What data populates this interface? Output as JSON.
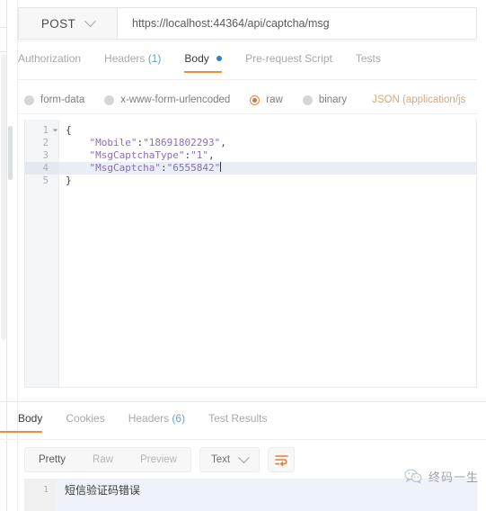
{
  "request": {
    "method": "POST",
    "url": "https://localhost:44364/api/captcha/msg",
    "tabs": [
      {
        "label": "Authorization",
        "name": "authorization"
      },
      {
        "label": "Headers",
        "count": "(1)",
        "name": "headers"
      },
      {
        "label": "Body",
        "name": "body"
      },
      {
        "label": "Pre-request Script",
        "name": "pre-request-script"
      },
      {
        "label": "Tests",
        "name": "tests"
      }
    ],
    "body_types": [
      {
        "label": "form-data",
        "name": "form-data"
      },
      {
        "label": "x-www-form-urlencoded",
        "name": "x-www-form-urlencoded"
      },
      {
        "label": "raw",
        "name": "raw"
      },
      {
        "label": "binary",
        "name": "binary"
      }
    ],
    "content_type": "JSON (application/js",
    "editor": {
      "line_numbers": [
        "1",
        "2",
        "3",
        "4",
        "5"
      ],
      "lines": [
        {
          "prefix": "{",
          "key": "",
          "sep": "",
          "value": "",
          "suffix": ""
        },
        {
          "prefix": "    ",
          "key": "\"Mobile\"",
          "sep": ":",
          "value": "\"18691802293\"",
          "suffix": ","
        },
        {
          "prefix": "    ",
          "key": "\"MsgCaptchaType\"",
          "sep": ":",
          "value": "\"1\"",
          "suffix": ","
        },
        {
          "prefix": "    ",
          "key": "\"MsgCaptcha\"",
          "sep": ":",
          "value": "\"6555842\"",
          "suffix": ""
        },
        {
          "prefix": "}",
          "key": "",
          "sep": "",
          "value": "",
          "suffix": ""
        }
      ]
    }
  },
  "response": {
    "tabs": [
      {
        "label": "Body",
        "name": "body"
      },
      {
        "label": "Cookies",
        "name": "cookies"
      },
      {
        "label": "Headers",
        "count": "(6)",
        "name": "headers"
      },
      {
        "label": "Test Results",
        "name": "test-results"
      }
    ],
    "view_modes": [
      {
        "label": "Pretty",
        "name": "pretty"
      },
      {
        "label": "Raw",
        "name": "raw"
      },
      {
        "label": "Preview",
        "name": "preview"
      }
    ],
    "format": "Text",
    "wrap_icon": "wrap-lines-icon",
    "body_line_number": "1",
    "body_text": "短信验证码错误"
  },
  "watermark": {
    "text": "终码一生",
    "icon": "wechat-logo-icon"
  },
  "colors": {
    "accent_orange": "#e8903a",
    "radio_selected": "#e2703a",
    "body_dot_blue": "#2f7fd8",
    "count_blue": "#6f9fc4",
    "json_string": "#8a6fb0",
    "content_type_tan": "#d6a878"
  }
}
